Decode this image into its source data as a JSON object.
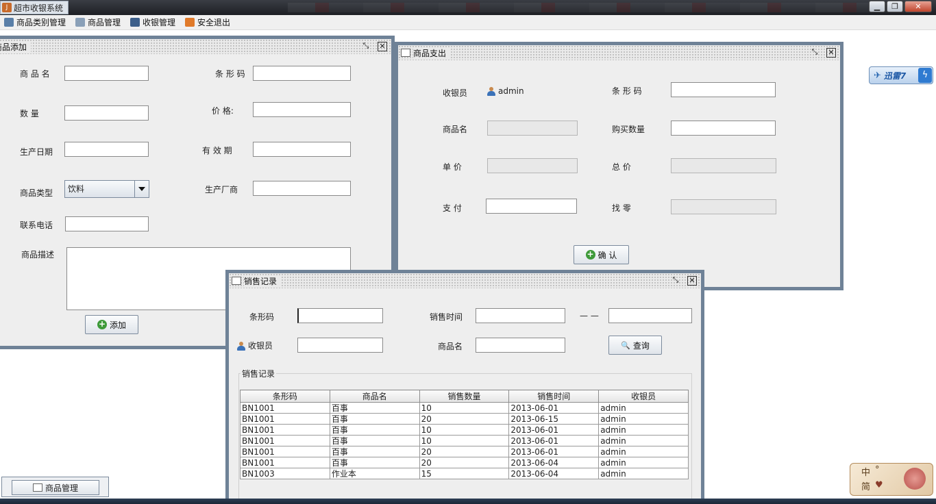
{
  "app": {
    "title": "超市收银系统",
    "icon_glyph": "J"
  },
  "window_controls": {
    "minimize": "▁",
    "restore": "❐",
    "close": "✕"
  },
  "menu": [
    {
      "label": "商品类别管理",
      "icon": "category-icon",
      "color": "#5a7fa8"
    },
    {
      "label": "商品管理",
      "icon": "document-icon",
      "color": "#8aa0b8"
    },
    {
      "label": "收银管理",
      "icon": "pen-icon",
      "color": "#3d5f8a"
    },
    {
      "label": "安全退出",
      "icon": "exit-icon",
      "color": "#e07a2a"
    }
  ],
  "add_window": {
    "title": "商品添加",
    "max_glyph": "⤡",
    "close_glyph": "✕",
    "labels": {
      "name": "商 品 名",
      "barcode": "条 形 码",
      "qty": "数   量",
      "price": "价   格:",
      "prod_date": "生产日期",
      "expiry": "有 效 期",
      "type": "商品类型",
      "maker": "生产厂商",
      "phone": "联系电话",
      "desc": "商品描述"
    },
    "type_value": "饮料",
    "add_button": "添加",
    "plus_glyph": "+"
  },
  "pay_window": {
    "title": "商品支出",
    "max_glyph": "⤡",
    "close_glyph": "✕",
    "labels": {
      "cashier": "收银员",
      "barcode": "条 形 码",
      "name": "商品名",
      "buy_qty": "购买数量",
      "unit_price": "单   价",
      "total": "总   价",
      "pay": "支   付",
      "change": "找   零"
    },
    "cashier_value": "admin",
    "confirm_button": "确 认",
    "plus_glyph": "+"
  },
  "sales_window": {
    "title": "销售记录",
    "max_glyph": "⤡",
    "close_glyph": "✕",
    "labels": {
      "barcode": "条形码",
      "sale_time": "销售时间",
      "sep": "— —",
      "cashier": "收银员",
      "name": "商品名",
      "group": "销售记录"
    },
    "query_button": "查询",
    "search_glyph": "🔍",
    "columns": [
      "条形码",
      "商品名",
      "销售数量",
      "销售时间",
      "收银员"
    ],
    "rows": [
      [
        "BN1001",
        "百事",
        "10",
        "2013-06-01",
        "admin"
      ],
      [
        "BN1001",
        "百事",
        "20",
        "2013-06-15",
        "admin"
      ],
      [
        "BN1001",
        "百事",
        "10",
        "2013-06-01",
        "admin"
      ],
      [
        "BN1001",
        "百事",
        "10",
        "2013-06-01",
        "admin"
      ],
      [
        "BN1001",
        "百事",
        "20",
        "2013-06-01",
        "admin"
      ],
      [
        "BN1001",
        "百事",
        "20",
        "2013-06-04",
        "admin"
      ],
      [
        "BN1003",
        "作业本",
        "15",
        "2013-06-04",
        "admin"
      ]
    ]
  },
  "taskbar_item": {
    "label": "商品管理"
  },
  "xunlei": {
    "label": "迅雷7",
    "bird": "✈",
    "bolt": "ϟ"
  },
  "ime": {
    "zh": "中",
    "simp": "简",
    "dot": "°",
    "heart": "♥"
  }
}
